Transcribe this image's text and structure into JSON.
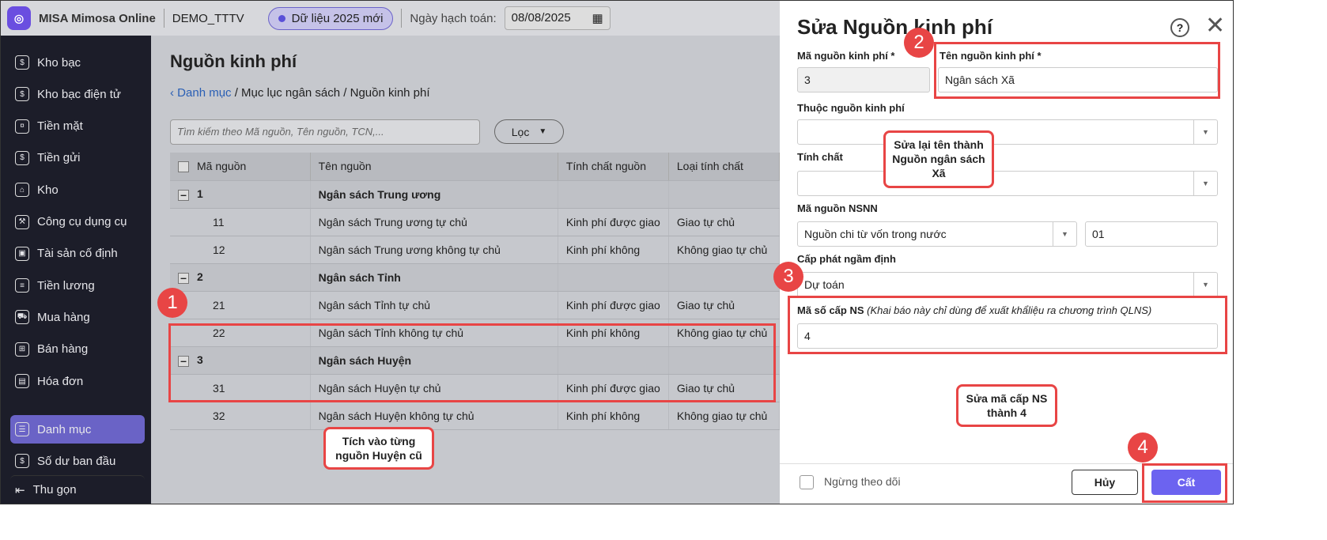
{
  "topbar": {
    "brand": "MISA Mimosa Online",
    "tenant": "DEMO_TTTV",
    "data_pill": "Dữ liệu 2025 mới",
    "date_label": "Ngày hạch toán:",
    "date_value": "08/08/2025"
  },
  "sidebar": {
    "items": [
      {
        "label": "Kho bạc",
        "icon": "$"
      },
      {
        "label": "Kho bạc điện tử",
        "icon": "$"
      },
      {
        "label": "Tiền mặt",
        "icon": "¤"
      },
      {
        "label": "Tiền gửi",
        "icon": "$"
      },
      {
        "label": "Kho",
        "icon": "⌂"
      },
      {
        "label": "Công cụ dụng cụ",
        "icon": "⚒"
      },
      {
        "label": "Tài sản cố định",
        "icon": "▣"
      },
      {
        "label": "Tiền lương",
        "icon": "≡"
      },
      {
        "label": "Mua hàng",
        "icon": "⛟"
      },
      {
        "label": "Bán hàng",
        "icon": "⊞"
      },
      {
        "label": "Hóa đơn",
        "icon": "▤"
      },
      {
        "label": "Danh mục",
        "icon": "☰"
      },
      {
        "label": "Số dư ban đầu",
        "icon": "$"
      }
    ],
    "collapse": "Thu gọn"
  },
  "main": {
    "title": "Nguồn kinh phí",
    "breadcrumb": {
      "root": "Danh mục",
      "rest": " / Mục lục ngân sách / Nguồn kinh phí"
    },
    "search_placeholder": "Tìm kiếm theo Mã nguồn, Tên nguồn, TCN,...",
    "filter": "Lọc",
    "columns": [
      "Mã nguồn",
      "Tên nguồn",
      "Tính chất nguồn",
      "Loại tính chất"
    ],
    "rows": [
      {
        "group": true,
        "code": "1",
        "name": "Ngân sách Trung ương",
        "prop": "",
        "type": ""
      },
      {
        "code": "11",
        "name": "Ngân sách Trung ương tự chủ",
        "prop": "Kinh phí được giao",
        "type": "Giao tự chủ"
      },
      {
        "code": "12",
        "name": "Ngân sách Trung ương không tự chủ",
        "prop": "Kinh phí không",
        "type": "Không giao tự chủ"
      },
      {
        "group": true,
        "code": "2",
        "name": "Ngân sách Tỉnh",
        "prop": "",
        "type": ""
      },
      {
        "code": "21",
        "name": "Ngân sách Tỉnh tự chủ",
        "prop": "Kinh phí được giao",
        "type": "Giao tự chủ"
      },
      {
        "code": "22",
        "name": "Ngân sách Tỉnh không tự chủ",
        "prop": "Kinh phí không",
        "type": "Không giao tự chủ"
      },
      {
        "group": true,
        "code": "3",
        "name": "Ngân sách Huyện",
        "prop": "",
        "type": ""
      },
      {
        "code": "31",
        "name": "Ngân sách Huyện tự chủ",
        "prop": "Kinh phí được giao",
        "type": "Giao tự chủ"
      },
      {
        "code": "32",
        "name": "Ngân sách Huyện không tự chủ",
        "prop": "Kinh phí không",
        "type": "Không giao tự chủ"
      }
    ]
  },
  "panel": {
    "title": "Sửa Nguồn kinh phí",
    "code_label": "Mã nguồn kinh phí *",
    "code_value": "3",
    "name_label": "Tên nguồn kinh phí *",
    "name_value": "Ngân sách Xã",
    "parent_label": "Thuộc nguồn kinh phí",
    "prop_label": "Tính chất",
    "nsnn_label": "Mã nguồn NSNN",
    "nsnn_value": "Nguồn chi từ vốn trong nước",
    "nsnn_code": "01",
    "alloc_label": "Cấp phát ngầm định",
    "alloc_value": "Dự toán",
    "level_label": "Mã số cấp NS",
    "level_note": "(Khai báo này chỉ dùng để xuất khẩliệu ra chương trình QLNS)",
    "level_value": "4",
    "stop_follow": "Ngừng theo dõi",
    "cancel": "Hủy",
    "save": "Cất"
  },
  "annotations": {
    "b1": "1",
    "b2": "2",
    "b3": "3",
    "b4": "4",
    "c1": "Tích vào từng nguồn Huyện cũ",
    "c2": "Sửa lại tên thành Nguồn ngân sách Xã",
    "c3": "Sửa mã cấp NS thành 4"
  },
  "colors": {
    "accent": "#6a63c6",
    "annotation": "#e84545",
    "save": "#6c63f0"
  }
}
